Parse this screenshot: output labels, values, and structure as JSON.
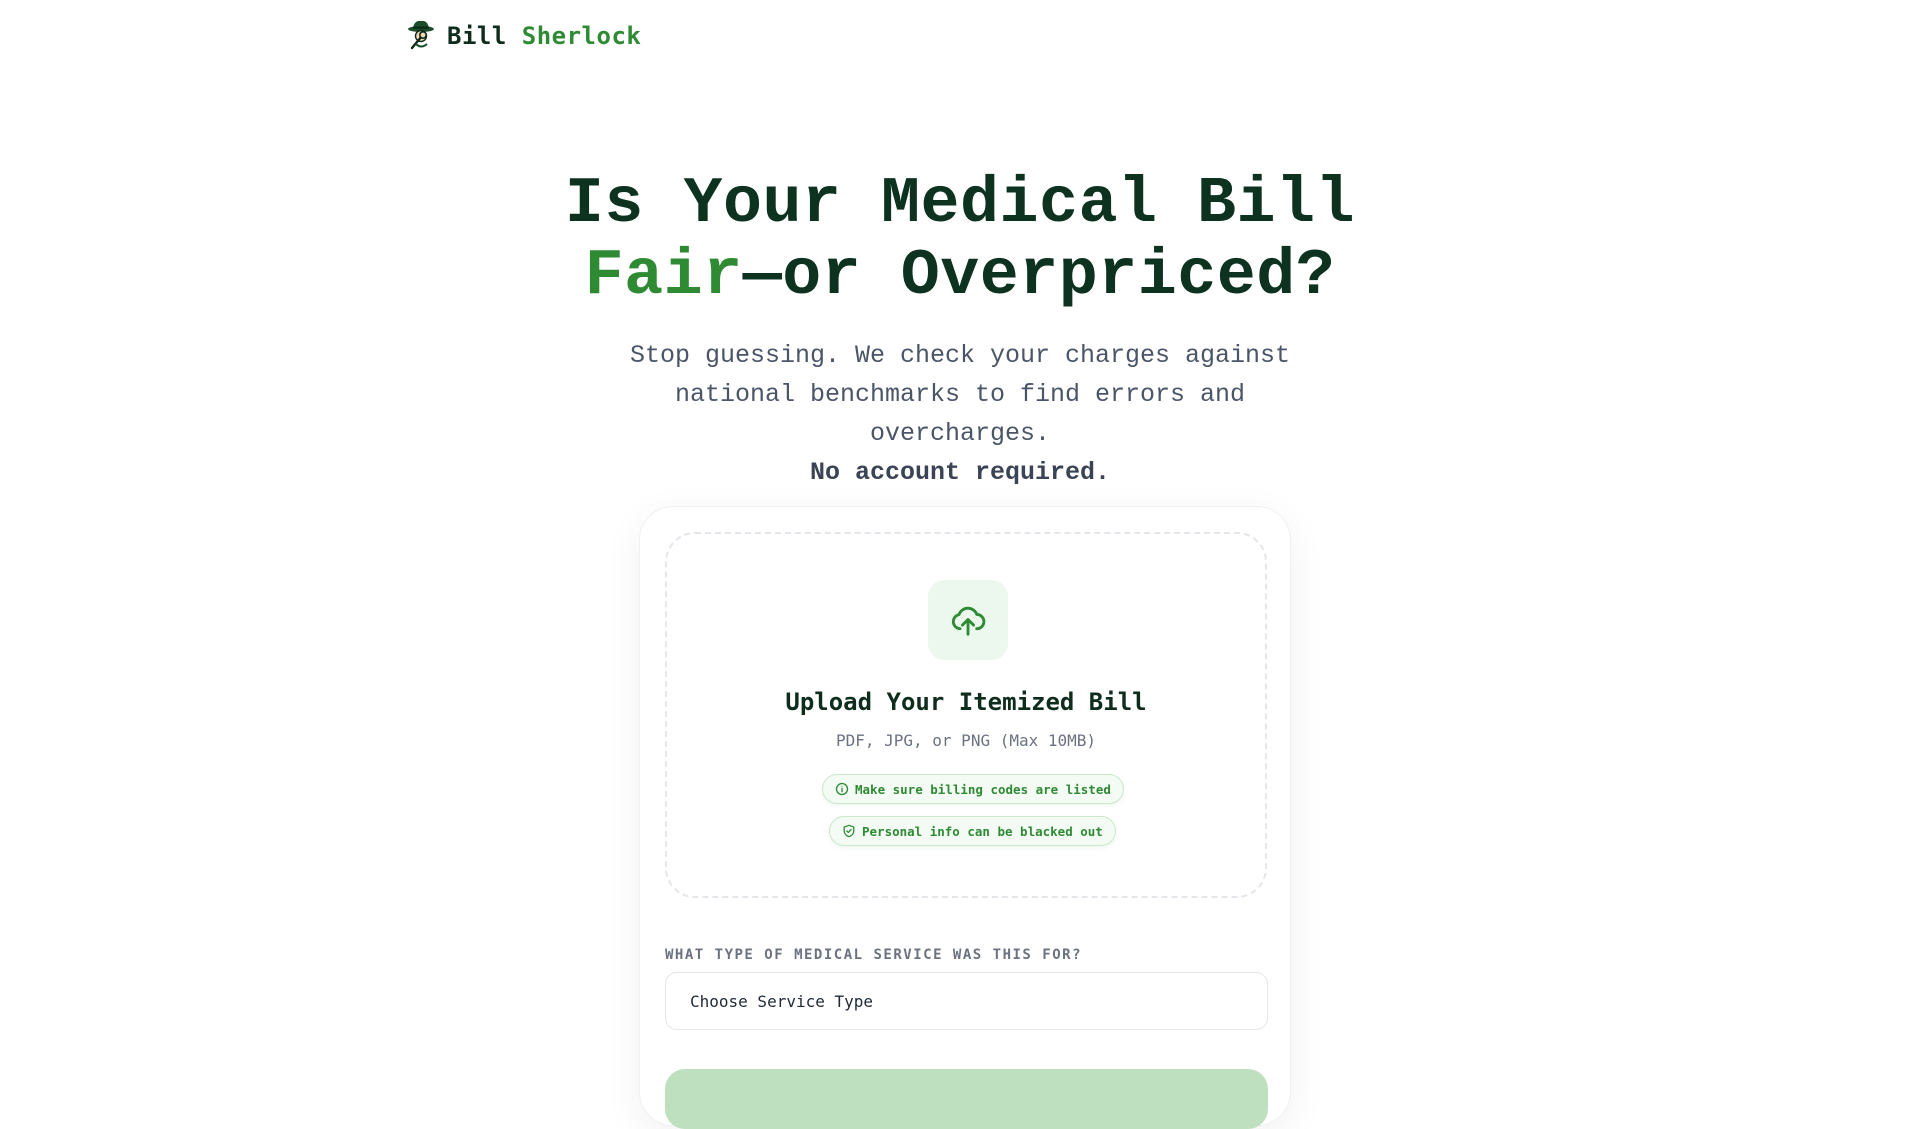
{
  "brand": {
    "name_part1": "Bill",
    "name_part2": "Sherlock",
    "logo_icon": "detective-icon"
  },
  "hero": {
    "title_line1": "Is Your Medical Bill",
    "title_accent": "Fair",
    "title_rest": "—or Overpriced?",
    "subtitle": "Stop guessing. We check your charges against national benchmarks to find errors and overcharges.",
    "subtitle_bold": "No account required."
  },
  "upload": {
    "icon": "cloud-upload-icon",
    "title": "Upload Your Itemized Bill",
    "formats": "PDF, JPG, or PNG (Max 10MB)",
    "tips": [
      {
        "icon": "info-icon",
        "label": "Make sure billing codes are listed"
      },
      {
        "icon": "shield-icon",
        "label": "Personal info can be blacked out"
      }
    ]
  },
  "service": {
    "label": "WHAT TYPE OF MEDICAL SERVICE WAS THIS FOR?",
    "selected": "Choose Service Type"
  },
  "colors": {
    "brand_dark": "#0f2d1c",
    "brand_green": "#2f8a34",
    "submit_disabled": "#bfe0bf"
  }
}
